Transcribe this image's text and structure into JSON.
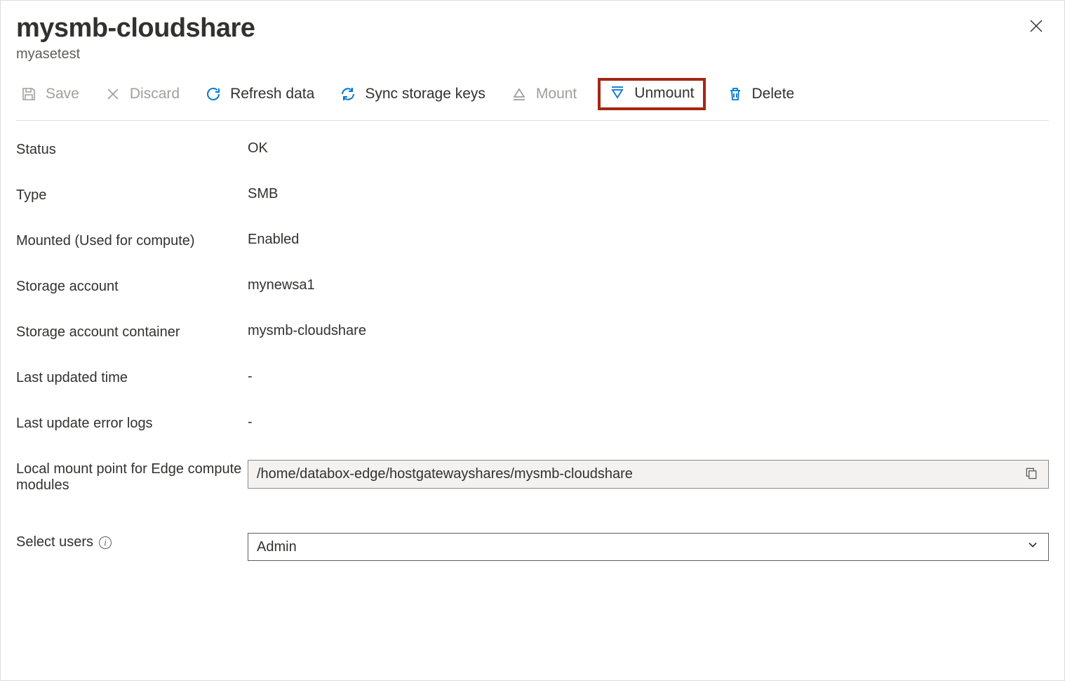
{
  "header": {
    "title": "mysmb-cloudshare",
    "subtitle": "myasetest"
  },
  "toolbar": {
    "save": "Save",
    "discard": "Discard",
    "refresh": "Refresh data",
    "sync": "Sync storage keys",
    "mount": "Mount",
    "unmount": "Unmount",
    "delete": "Delete"
  },
  "fields": {
    "status": {
      "label": "Status",
      "value": "OK"
    },
    "type": {
      "label": "Type",
      "value": "SMB"
    },
    "mounted": {
      "label": "Mounted (Used for compute)",
      "value": "Enabled"
    },
    "storage_account": {
      "label": "Storage account",
      "value": "mynewsa1"
    },
    "storage_container": {
      "label": "Storage account container",
      "value": "mysmb-cloudshare"
    },
    "last_updated": {
      "label": "Last updated time",
      "value": "-"
    },
    "last_error": {
      "label": "Last update error logs",
      "value": "-"
    },
    "mount_point": {
      "label": "Local mount point for Edge compute modules",
      "value": "/home/databox-edge/hostgatewayshares/mysmb-cloudshare"
    },
    "select_users": {
      "label": "Select users",
      "value": "Admin"
    }
  }
}
